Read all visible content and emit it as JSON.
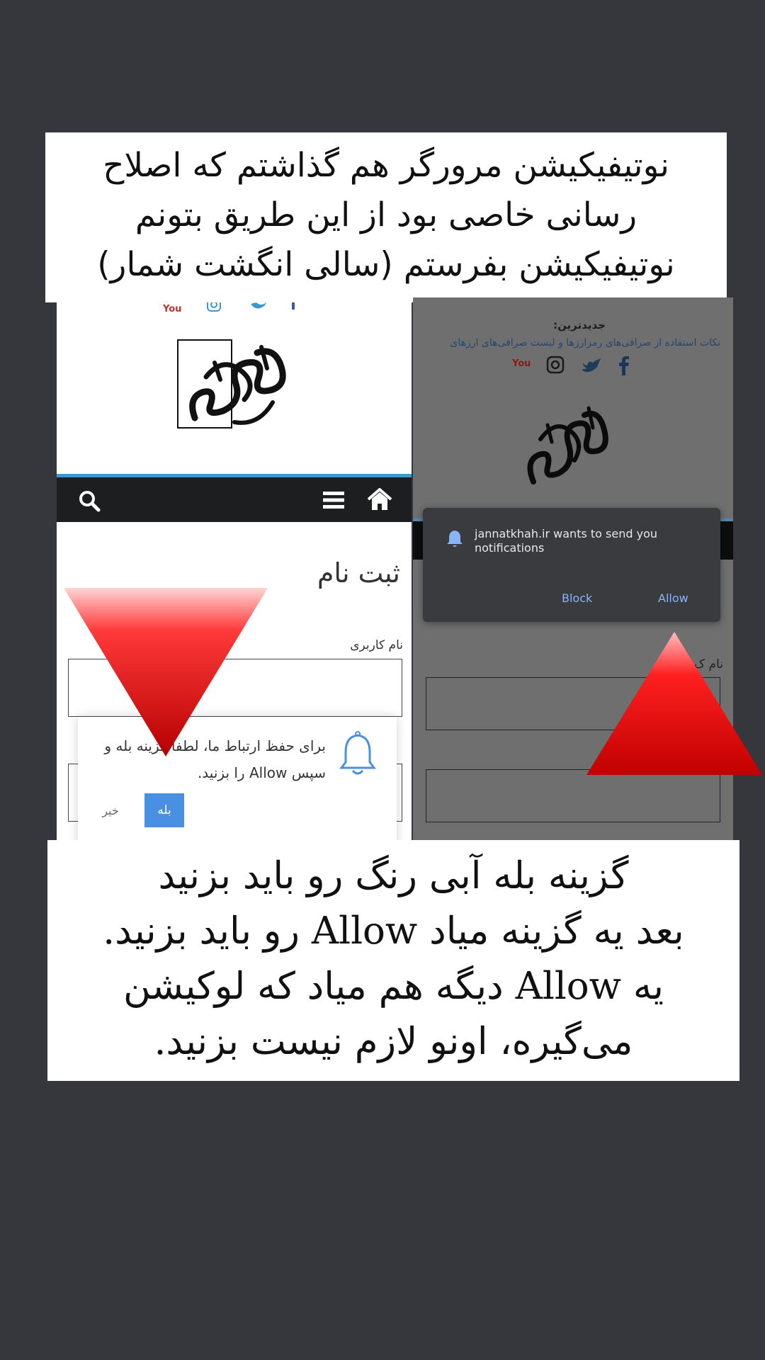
{
  "captions": {
    "top": [
      "نوتیفیکیشن مرورگر هم گذاشتم که اصلاح",
      "رسانی خاصی بود از این طریق بتونم",
      "نوتیفیکیشن بفرستم (سالی انگشت شمار)"
    ],
    "bottom": [
      "گزینه بله آبی رنگ رو باید بزنید",
      "بعد یه گزینه میاد Allow رو باید بزنید.",
      "یه Allow دیگه هم میاد که لوکیشن",
      "می‌گیره، اونو لازم نیست بزنید."
    ]
  },
  "left_screen": {
    "social_icons": [
      "youtube-icon",
      "instagram-icon",
      "twitter-icon",
      "facebook-icon"
    ],
    "logo_icon": "calligraphy-logo-icon",
    "navbar": {
      "search_icon": "search-icon",
      "menu_icon": "hamburger-menu-icon",
      "home_icon": "home-icon"
    },
    "register_title": "ثبت نام",
    "username_label": "نام کاربری",
    "push_prompt": {
      "text": "برای حفظ ارتباط ما، لطفا گزینه بله و سپس Allow را بزنید.",
      "yes_label": "بله",
      "no_label": "خیر"
    }
  },
  "right_screen": {
    "latest_title": "جدیدترین:",
    "latest_link": "نکات استفاده از صرافی‌های رمزارزها و لیست صرافی‌های ارزهای",
    "label_fragment": "نام ک",
    "permission_dialog": {
      "message": "jannatkhah.ir wants to send you notifications",
      "block_label": "Block",
      "allow_label": "Allow"
    }
  },
  "colors": {
    "background": "#36373c",
    "accent_blue": "#3e97d1",
    "navbar": "#1d1e20",
    "yes_button": "#4a90e2",
    "arrow_red": "#e1121b",
    "dialog_link": "#8ab4f8"
  }
}
